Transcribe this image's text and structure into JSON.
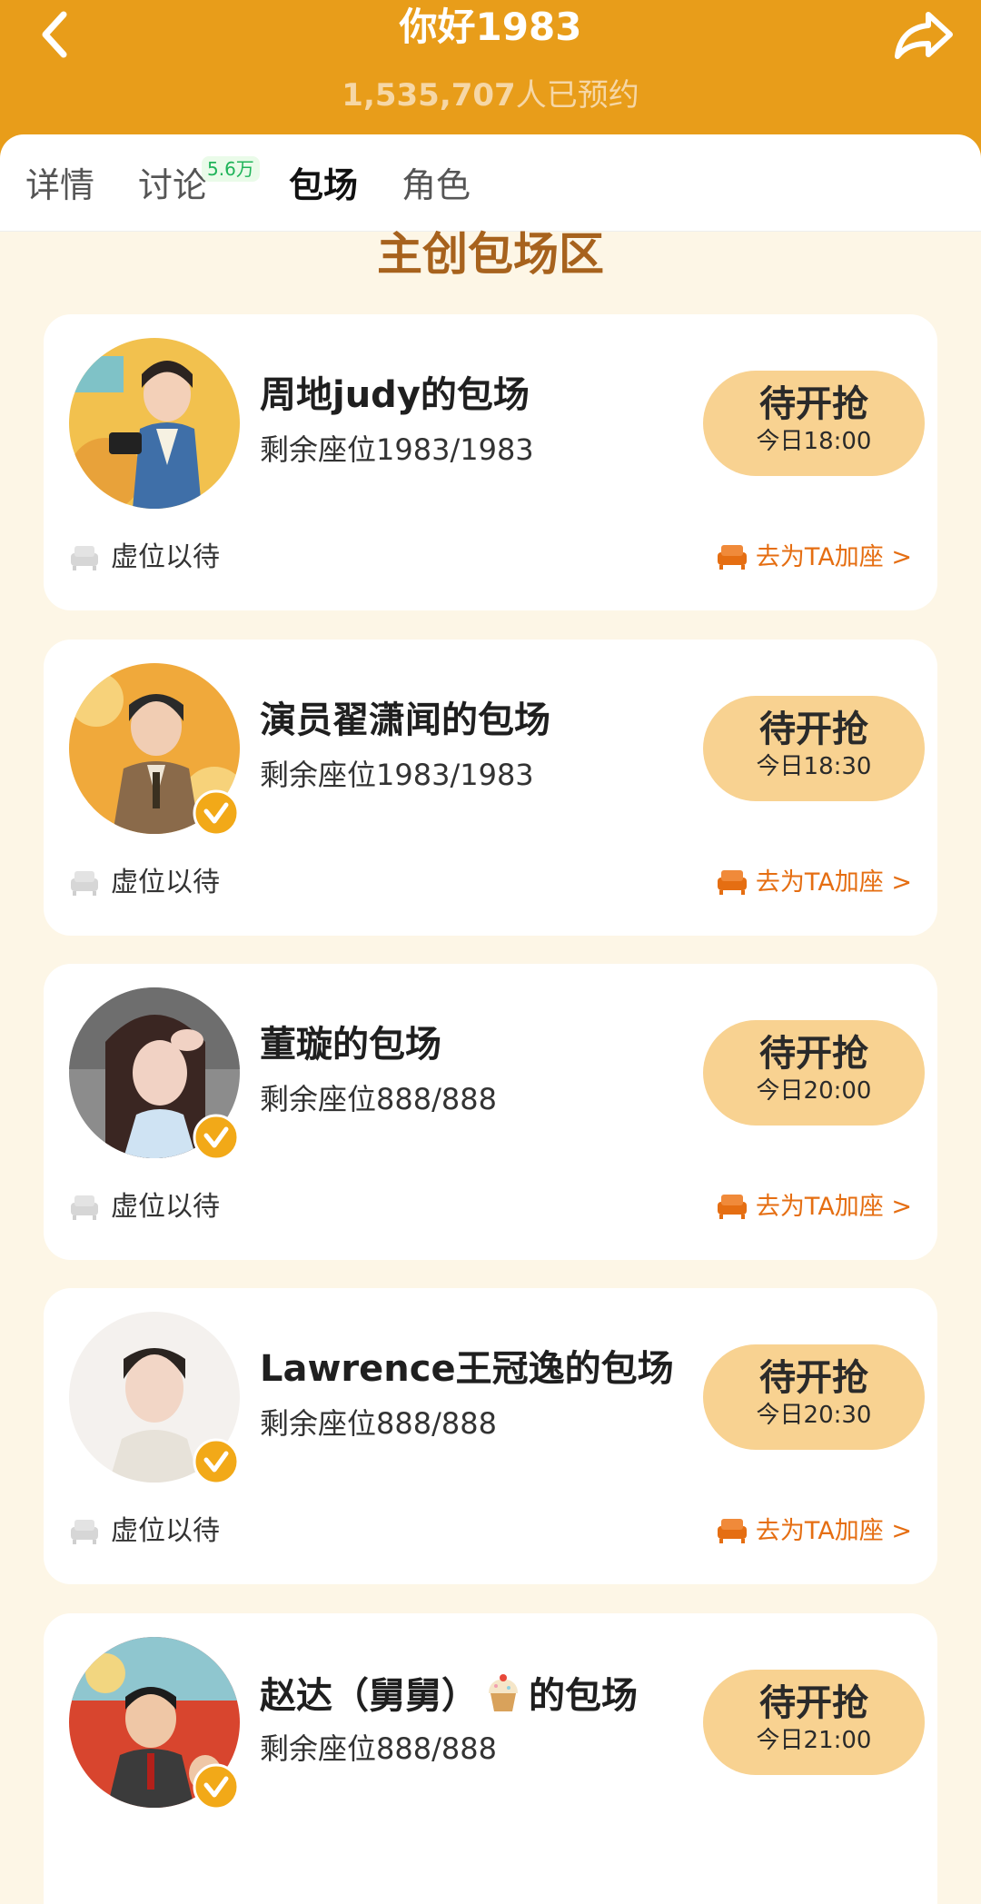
{
  "header": {
    "title": "你好1983",
    "reserve_count": "1,535,707",
    "reserve_suffix": "人已预约"
  },
  "tabs": [
    {
      "label": "详情",
      "active": false
    },
    {
      "label": "讨论",
      "active": false,
      "badge": "5.6万"
    },
    {
      "label": "包场",
      "active": true
    },
    {
      "label": "角色",
      "active": false
    }
  ],
  "section_title": "主创包场区",
  "cards": [
    {
      "name": "周地judy的包场",
      "seats": "剩余座位1983/1983",
      "button": "待开抢",
      "time": "今日18:00",
      "vacant": "虚位以待",
      "add_seat": "去为TA加座 >",
      "verified": false
    },
    {
      "name": "演员翟潇闻的包场",
      "seats": "剩余座位1983/1983",
      "button": "待开抢",
      "time": "今日18:30",
      "vacant": "虚位以待",
      "add_seat": "去为TA加座 >",
      "verified": true
    },
    {
      "name": "董璇的包场",
      "seats": "剩余座位888/888",
      "button": "待开抢",
      "time": "今日20:00",
      "vacant": "虚位以待",
      "add_seat": "去为TA加座 >",
      "verified": true
    },
    {
      "name": "Lawrence王冠逸的包场",
      "seats": "剩余座位888/888",
      "button": "待开抢",
      "time": "今日20:30",
      "vacant": "虚位以待",
      "add_seat": "去为TA加座 >",
      "verified": true
    },
    {
      "name_prefix": "赵达（舅舅）",
      "name_suffix": "的包场",
      "seats": "剩余座位888/888",
      "button": "待开抢",
      "time": "今日21:00",
      "verified": true
    }
  ],
  "colors": {
    "header_bg": "#e89d1a",
    "page_bg": "#fdf6e6",
    "button_bg": "#f8d291",
    "accent_orange": "#e56e12",
    "section_title": "#a7621d"
  },
  "icons": {
    "back": "chevron-left-icon",
    "share": "share-arrow-icon",
    "vacant": "sofa-icon",
    "add_seat": "sofa-icon",
    "verified": "verified-check-icon",
    "emoji": "cupcake-icon"
  }
}
